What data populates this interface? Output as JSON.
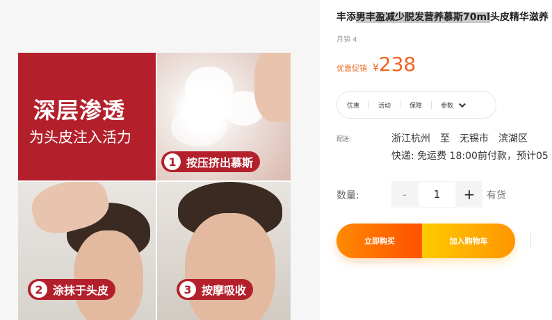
{
  "product": {
    "title_prefix": "丰添",
    "title_highlight": "男丰盈减少脱发营养慕斯70ml",
    "title_suffix": "头皮精华滋养",
    "sales": "月销 4",
    "promo_label": "优惠促销",
    "price_currency": "¥",
    "price": "238"
  },
  "services": {
    "items": [
      "优惠",
      "活动",
      "保障",
      "参数"
    ]
  },
  "shipping": {
    "label": "配送:",
    "from": "浙江杭州",
    "to_word": "至",
    "city": "无锡市",
    "district": "滨湖区",
    "line2": "快递: 免运费  18:00前付款，预计05"
  },
  "quantity": {
    "label": "数量:",
    "minus": "-",
    "value": "1",
    "plus": "+",
    "stock": "有货"
  },
  "actions": {
    "buy_now": "立即购买",
    "add_to_cart": "加入购物车"
  },
  "gallery": {
    "headline": "深层渗透",
    "subheadline": "为头皮注入活力",
    "steps": [
      {
        "num": "1",
        "label": "按压挤出慕斯"
      },
      {
        "num": "2",
        "label": "涂抹于头皮"
      },
      {
        "num": "3",
        "label": "按摩吸收"
      }
    ]
  },
  "colors": {
    "accent_red": "#b3202c",
    "price_orange": "#f2621f",
    "buy_gradient": "#ff5000",
    "cart_gradient": "#ffcb00"
  }
}
